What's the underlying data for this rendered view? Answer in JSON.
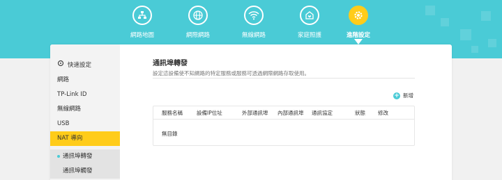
{
  "header": {
    "nav": [
      {
        "label": "網路地圖",
        "icon": "network-map-icon",
        "active": false
      },
      {
        "label": "網際網路",
        "icon": "globe-icon",
        "active": false
      },
      {
        "label": "無線網路",
        "icon": "wifi-icon",
        "active": false
      },
      {
        "label": "家庭照護",
        "icon": "home-care-icon",
        "active": false
      },
      {
        "label": "進階設定",
        "icon": "gear-icon",
        "active": true
      }
    ]
  },
  "sidebar": {
    "quick_setup": "快速設定",
    "items": [
      {
        "label": "網路"
      },
      {
        "label": "TP-Link ID"
      },
      {
        "label": "無線網路"
      },
      {
        "label": "USB"
      },
      {
        "label": "NAT 導向"
      }
    ],
    "subitems": [
      {
        "label": "通訊埠轉發"
      },
      {
        "label": "通訊埠觸發"
      }
    ]
  },
  "main": {
    "title": "通訊埠轉發",
    "description": "設定這設備使不知網路的特定服務或服務可透過網際網路存取使用。",
    "add_label": "新增",
    "table": {
      "columns": [
        "服務名稱",
        "設備IP位址",
        "外部通訊埠",
        "內部通訊埠",
        "通訊協定",
        "狀態",
        "修改"
      ],
      "empty_text": "無目錄"
    }
  },
  "colors": {
    "header": "#4acbd6",
    "accent": "#ffcc1a"
  }
}
